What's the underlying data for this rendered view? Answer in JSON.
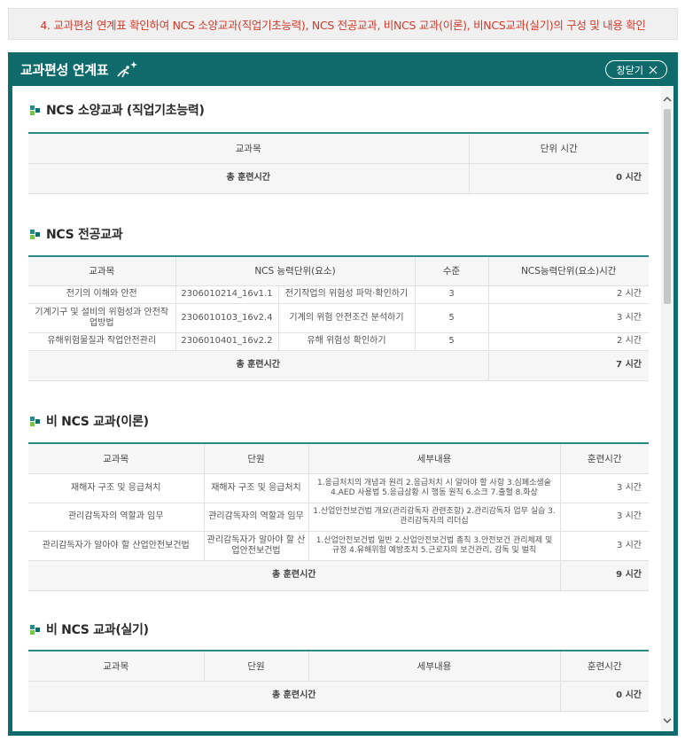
{
  "banner": "4. 교과편성 연계표 확인하여 NCS 소양교과(직업기초능력), NCS 전공교과, 비NCS 교과(이론), 비NCS교과(실기)의 구성 및 내용 확인",
  "modal": {
    "title": "교과편성 연계표",
    "close_label": "창닫기"
  },
  "colors": {
    "header": "#0f6b6b",
    "banner_text": "#d23b2c",
    "table_accent": "#2a8a86"
  },
  "sections": {
    "basic": {
      "title": "NCS 소양교과 (직업기초능력)",
      "headers": [
        "교과목",
        "단위 시간"
      ],
      "total_label": "총 훈련시간",
      "total": "0 시간"
    },
    "major": {
      "title": "NCS 전공교과",
      "headers": [
        "교과목",
        "NCS 능력단위(요소)",
        "수준",
        "NCS능력단위(요소)시간"
      ],
      "rows": [
        {
          "subject": "전기의 이해와 안전",
          "code": "2306010214_16v1.1",
          "element": "전기작업의 위험성 파악·확인하기",
          "level": "3",
          "hours": "2 시간"
        },
        {
          "subject": "기계기구 및 설비의 위험성과 안전작업방법",
          "code": "2306010103_16v2.4",
          "element": "기계의 위험 안전조건 분석하기",
          "level": "5",
          "hours": "3 시간"
        },
        {
          "subject": "유해위험물질과 작업안전관리",
          "code": "2306010401_16v2.2",
          "element": "유해 위험성 확인하기",
          "level": "5",
          "hours": "2 시간"
        }
      ],
      "total_label": "총 훈련시간",
      "total": "7 시간"
    },
    "theory": {
      "title": "비 NCS 교과(이론)",
      "headers": [
        "교과목",
        "단원",
        "세부내용",
        "훈련시간"
      ],
      "rows": [
        {
          "subject": "재해자 구조 및 응급처치",
          "unit": "재해자 구조 및 응급처치",
          "detail": "1.응급처치의 개념과 원리 2.응급처치 시 알아야 할 사항 3.심폐소생술 4.AED 사용법 5.응급상황 시 행동 원칙 6.쇼크 7.출혈 8.화상",
          "hours": "3 시간"
        },
        {
          "subject": "관리감독자의 역할과 임무",
          "unit": "관리감독자의 역할과 임무",
          "detail": "1.산업안전보건법 개요(관리감독자 관련조항) 2.관리감독자 업무 실습 3.관리감독자의 리더십",
          "hours": "3 시간"
        },
        {
          "subject": "관리감독자가 알아야 할 산업안전보건법",
          "unit": "관리감독자가 알아야 할 산업안전보건법",
          "detail": "1.산업안전보건법 일반 2.산업안전보건법 총칙 3.안전보건 관리체제 및 규정 4.유해위험 예방조치 5.근로자의 보건관리, 감독 및 벌칙",
          "hours": "3 시간"
        }
      ],
      "total_label": "총 훈련시간",
      "total": "9 시간"
    },
    "practice": {
      "title": "비 NCS 교과(실기)",
      "headers": [
        "교과목",
        "단원",
        "세부내용",
        "훈련시간"
      ],
      "total_label": "총 훈련시간",
      "total": "0 시간"
    }
  }
}
